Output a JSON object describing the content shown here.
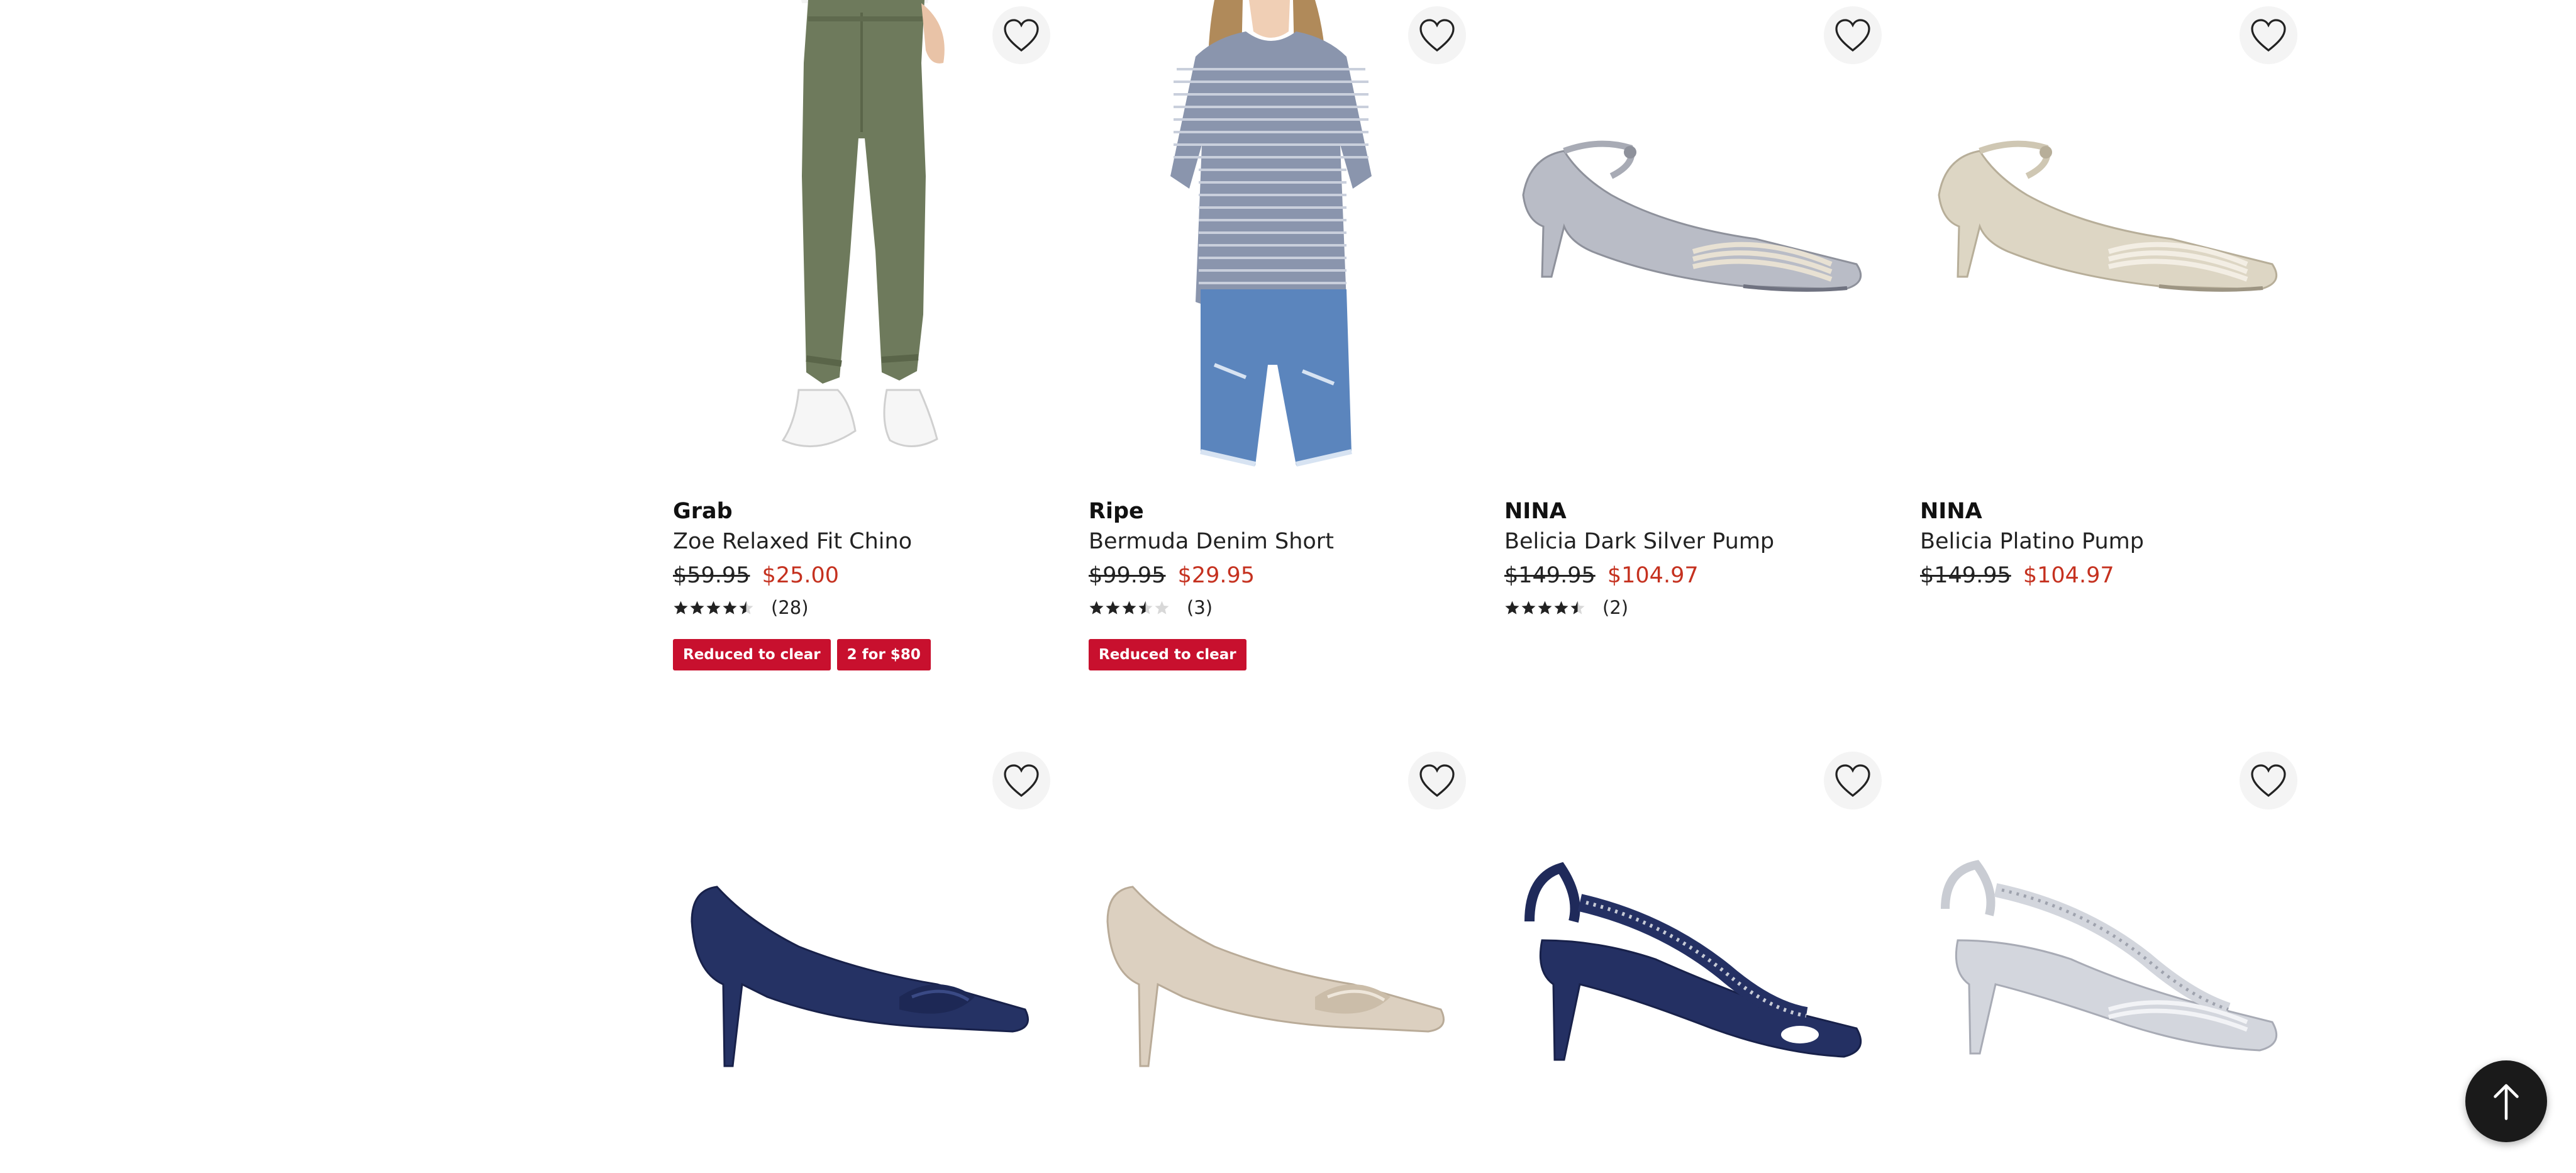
{
  "products": [
    {
      "brand": "Grab",
      "name": "Zoe Relaxed Fit Chino",
      "original_price": "$59.95",
      "sale_price": "$25.00",
      "rating": 4.5,
      "review_count": "(28)",
      "badges": [
        "Reduced to clear",
        "2 for $80"
      ],
      "image": "olive-chino-pants-model"
    },
    {
      "brand": "Ripe",
      "name": "Bermuda Denim Short",
      "original_price": "$99.95",
      "sale_price": "$29.95",
      "rating": 3.5,
      "review_count": "(3)",
      "badges": [
        "Reduced to clear"
      ],
      "image": "striped-tee-denim-short-model"
    },
    {
      "brand": "NINA",
      "name": "Belicia Dark Silver Pump",
      "original_price": "$149.95",
      "sale_price": "$104.97",
      "rating": 4.5,
      "review_count": "(2)",
      "badges": [],
      "image": "silver-slingback-pump"
    },
    {
      "brand": "NINA",
      "name": "Belicia Platino Pump",
      "original_price": "$149.95",
      "sale_price": "$104.97",
      "rating": null,
      "review_count": "",
      "badges": [],
      "image": "platino-slingback-pump"
    },
    {
      "brand": "",
      "name": "",
      "original_price": "",
      "sale_price": "",
      "rating": null,
      "review_count": "",
      "badges": [],
      "image": "navy-satin-pump"
    },
    {
      "brand": "",
      "name": "",
      "original_price": "",
      "sale_price": "",
      "rating": null,
      "review_count": "",
      "badges": [],
      "image": "champagne-satin-pump"
    },
    {
      "brand": "",
      "name": "",
      "original_price": "",
      "sale_price": "",
      "rating": null,
      "review_count": "",
      "badges": [],
      "image": "navy-jeweled-slingback-sandal"
    },
    {
      "brand": "",
      "name": "",
      "original_price": "",
      "sale_price": "",
      "rating": null,
      "review_count": "",
      "badges": [],
      "image": "silver-jeweled-slingback-sandal"
    }
  ],
  "icons": {
    "favorite": "heart-outline-icon",
    "back_to_top": "arrow-up-icon"
  },
  "colors": {
    "sale_price": "#c5311f",
    "badge": "#c8102e",
    "back_to_top_bg": "#1a1a1a"
  }
}
